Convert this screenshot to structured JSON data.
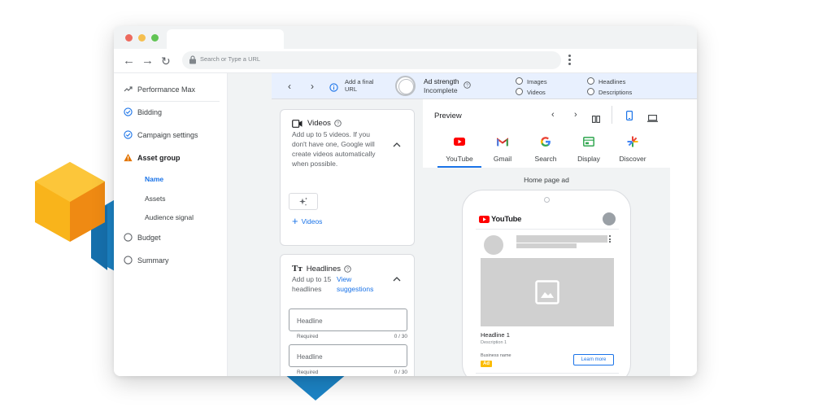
{
  "browser": {
    "address_placeholder": "Search or Type a URL",
    "traffic_colors": [
      "#ed6a5e",
      "#f5bf4f",
      "#61c454"
    ]
  },
  "sidebar": {
    "items": [
      {
        "label": "Performance Max",
        "icon": "arrow-trend-icon"
      },
      {
        "label": "Bidding",
        "icon": "check-circle-icon"
      },
      {
        "label": "Campaign settings",
        "icon": "check-circle-icon"
      },
      {
        "label": "Asset group",
        "icon": "warning-icon"
      },
      {
        "label": "Budget",
        "icon": "empty-circle-icon"
      },
      {
        "label": "Summary",
        "icon": "empty-circle-icon"
      }
    ],
    "subitems": [
      {
        "label": "Name",
        "active": true
      },
      {
        "label": "Assets"
      },
      {
        "label": "Audience signal"
      }
    ]
  },
  "strip": {
    "final_url_line1": "Add a final",
    "final_url_line2": "URL",
    "ad_strength_label": "Ad strength",
    "ad_strength_status": "Incomplete",
    "checks": [
      "Images",
      "Videos",
      "Headlines",
      "Descriptions"
    ]
  },
  "videos_card": {
    "title": "Videos",
    "desc": "Add up to 5 videos. If you don't have one, Google will create videos automatically when possible.",
    "add_label": "Videos"
  },
  "headlines_card": {
    "title": "Headlines",
    "desc_prefix": "Add up to 15 headlines",
    "view_link": "View suggestions",
    "fields": [
      {
        "placeholder": "Headline",
        "required": "Required",
        "count": "0 / 30"
      },
      {
        "placeholder": "Headline",
        "required": "Required",
        "count": "0 / 30"
      }
    ]
  },
  "preview": {
    "title": "Preview",
    "channels": [
      "YouTube",
      "Gmail",
      "Search",
      "Display",
      "Discover"
    ],
    "ad_type": "Home page ad",
    "ad": {
      "logo_text": "YouTube",
      "headline": "Headline 1",
      "description": "Description 1",
      "business": "Business name",
      "badge": "Ad",
      "cta": "Learn more"
    }
  },
  "colors": {
    "accent": "#1a73e8",
    "warning": "#e37400",
    "youtube_red": "#ff0000",
    "ad_badge": "#fbbc04"
  }
}
